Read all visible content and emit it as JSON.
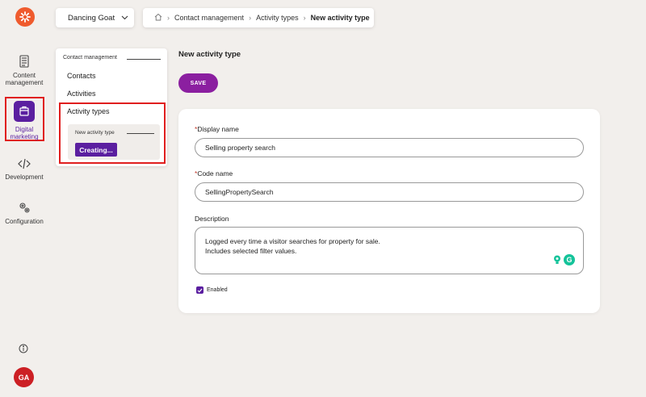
{
  "rail": {
    "items": [
      {
        "label": "Content\nmanagement",
        "icon": "content-management-icon"
      },
      {
        "label": "Digital\nmarketing",
        "icon": "digital-marketing-icon"
      },
      {
        "label": "Development",
        "icon": "code-icon"
      },
      {
        "label": "Configuration",
        "icon": "gear-icon"
      }
    ],
    "avatar": "GA"
  },
  "topbar": {
    "site": "Dancing Goat",
    "breadcrumb": [
      "Contact management",
      "Activity types",
      "New activity type"
    ]
  },
  "subnav": {
    "heading": "Contact management",
    "links": [
      "Contacts",
      "Activities",
      "Activity types"
    ],
    "child_label": "New activity type",
    "creating_label": "Creating..."
  },
  "main": {
    "title": "New activity type",
    "save_label": "SAVE",
    "display_name_label": "Display name",
    "display_name_value": "Selling property search",
    "code_name_label": "Code name",
    "code_name_value": "SellingPropertySearch",
    "description_label": "Description",
    "description_line1": "Logged every time a visitor searches for property for sale.",
    "description_line2": "Includes selected filter values.",
    "enabled_label": "Enabled",
    "required_marker": "*"
  },
  "colors": {
    "accent": "#5b1fa0",
    "save": "#8b1fa0",
    "highlight": "#e01e1e",
    "logo": "#ef5b2e"
  }
}
